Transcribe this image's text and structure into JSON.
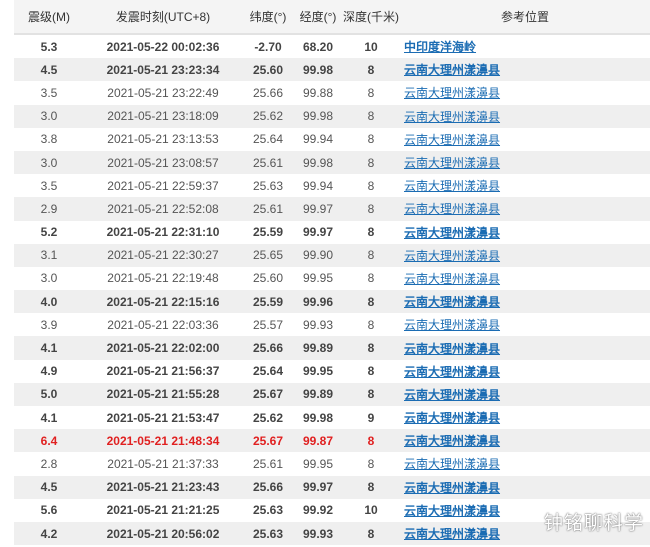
{
  "headers": [
    "震级(M)",
    "发震时刻(UTC+8)",
    "纬度(°)",
    "经度(°)",
    "深度(千米)",
    "参考位置"
  ],
  "highlight_color": "#e02020",
  "link_color": "#1b6cb3",
  "rows": [
    {
      "mag": "5.3",
      "time": "2021-05-22 00:02:36",
      "lat": "-2.70",
      "lon": "68.20",
      "depth": "10",
      "loc": "中印度洋海岭"
    },
    {
      "mag": "4.5",
      "time": "2021-05-21 23:23:34",
      "lat": "25.60",
      "lon": "99.98",
      "depth": "8",
      "loc": "云南大理州漾濞县"
    },
    {
      "mag": "3.5",
      "time": "2021-05-21 23:22:49",
      "lat": "25.66",
      "lon": "99.88",
      "depth": "8",
      "loc": "云南大理州漾濞县"
    },
    {
      "mag": "3.0",
      "time": "2021-05-21 23:18:09",
      "lat": "25.62",
      "lon": "99.98",
      "depth": "8",
      "loc": "云南大理州漾濞县"
    },
    {
      "mag": "3.8",
      "time": "2021-05-21 23:13:53",
      "lat": "25.64",
      "lon": "99.94",
      "depth": "8",
      "loc": "云南大理州漾濞县"
    },
    {
      "mag": "3.0",
      "time": "2021-05-21 23:08:57",
      "lat": "25.61",
      "lon": "99.98",
      "depth": "8",
      "loc": "云南大理州漾濞县"
    },
    {
      "mag": "3.5",
      "time": "2021-05-21 22:59:37",
      "lat": "25.63",
      "lon": "99.94",
      "depth": "8",
      "loc": "云南大理州漾濞县"
    },
    {
      "mag": "2.9",
      "time": "2021-05-21 22:52:08",
      "lat": "25.61",
      "lon": "99.97",
      "depth": "8",
      "loc": "云南大理州漾濞县"
    },
    {
      "mag": "5.2",
      "time": "2021-05-21 22:31:10",
      "lat": "25.59",
      "lon": "99.97",
      "depth": "8",
      "loc": "云南大理州漾濞县"
    },
    {
      "mag": "3.1",
      "time": "2021-05-21 22:30:27",
      "lat": "25.65",
      "lon": "99.90",
      "depth": "8",
      "loc": "云南大理州漾濞县"
    },
    {
      "mag": "3.0",
      "time": "2021-05-21 22:19:48",
      "lat": "25.60",
      "lon": "99.95",
      "depth": "8",
      "loc": "云南大理州漾濞县"
    },
    {
      "mag": "4.0",
      "time": "2021-05-21 22:15:16",
      "lat": "25.59",
      "lon": "99.96",
      "depth": "8",
      "loc": "云南大理州漾濞县"
    },
    {
      "mag": "3.9",
      "time": "2021-05-21 22:03:36",
      "lat": "25.57",
      "lon": "99.93",
      "depth": "8",
      "loc": "云南大理州漾濞县"
    },
    {
      "mag": "4.1",
      "time": "2021-05-21 22:02:00",
      "lat": "25.66",
      "lon": "99.89",
      "depth": "8",
      "loc": "云南大理州漾濞县"
    },
    {
      "mag": "4.9",
      "time": "2021-05-21 21:56:37",
      "lat": "25.64",
      "lon": "99.95",
      "depth": "8",
      "loc": "云南大理州漾濞县"
    },
    {
      "mag": "5.0",
      "time": "2021-05-21 21:55:28",
      "lat": "25.67",
      "lon": "99.89",
      "depth": "8",
      "loc": "云南大理州漾濞县"
    },
    {
      "mag": "4.1",
      "time": "2021-05-21 21:53:47",
      "lat": "25.62",
      "lon": "99.98",
      "depth": "9",
      "loc": "云南大理州漾濞县"
    },
    {
      "mag": "6.4",
      "time": "2021-05-21 21:48:34",
      "lat": "25.67",
      "lon": "99.87",
      "depth": "8",
      "loc": "云南大理州漾濞县",
      "highlight": true
    },
    {
      "mag": "2.8",
      "time": "2021-05-21 21:37:33",
      "lat": "25.61",
      "lon": "99.95",
      "depth": "8",
      "loc": "云南大理州漾濞县"
    },
    {
      "mag": "4.5",
      "time": "2021-05-21 21:23:43",
      "lat": "25.66",
      "lon": "99.97",
      "depth": "8",
      "loc": "云南大理州漾濞县"
    },
    {
      "mag": "5.6",
      "time": "2021-05-21 21:21:25",
      "lat": "25.63",
      "lon": "99.92",
      "depth": "10",
      "loc": "云南大理州漾濞县"
    },
    {
      "mag": "4.2",
      "time": "2021-05-21 20:56:02",
      "lat": "25.63",
      "lon": "99.93",
      "depth": "8",
      "loc": "云南大理州漾濞县"
    }
  ],
  "watermark": "钟铭聊科学"
}
